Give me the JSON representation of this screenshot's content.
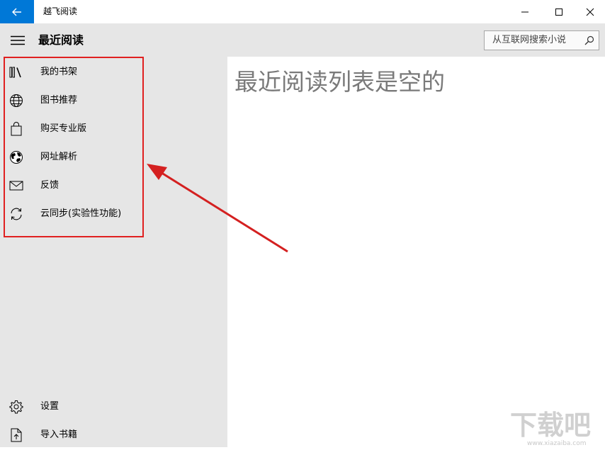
{
  "window": {
    "title": "越飞阅读",
    "controls": [
      "minimize",
      "maximize",
      "close"
    ]
  },
  "header": {
    "page_title": "最近阅读",
    "search_placeholder": "从互联网搜索小说"
  },
  "nav": {
    "items": [
      {
        "label": "我的书架",
        "icon": "bookshelf-icon"
      },
      {
        "label": "图书推荐",
        "icon": "globe-icon"
      },
      {
        "label": "购买专业版",
        "icon": "shopping-bag-icon"
      },
      {
        "label": "网址解析",
        "icon": "world-icon"
      },
      {
        "label": "反馈",
        "icon": "mail-icon"
      },
      {
        "label": "云同步(实验性功能)",
        "icon": "sync-icon"
      }
    ],
    "bottom_items": [
      {
        "label": "设置",
        "icon": "gear-icon"
      },
      {
        "label": "导入书籍",
        "icon": "import-file-icon"
      }
    ]
  },
  "main": {
    "empty_message": "最近阅读列表是空的"
  },
  "annotation": {
    "highlight_color": "#e02020"
  },
  "watermark": {
    "text": "下载吧",
    "url_text": "www.xiazaiba.com"
  },
  "colors": {
    "accent": "#0078d7",
    "sidebar_bg": "#e6e6e6",
    "empty_text": "#7a7a7a"
  }
}
